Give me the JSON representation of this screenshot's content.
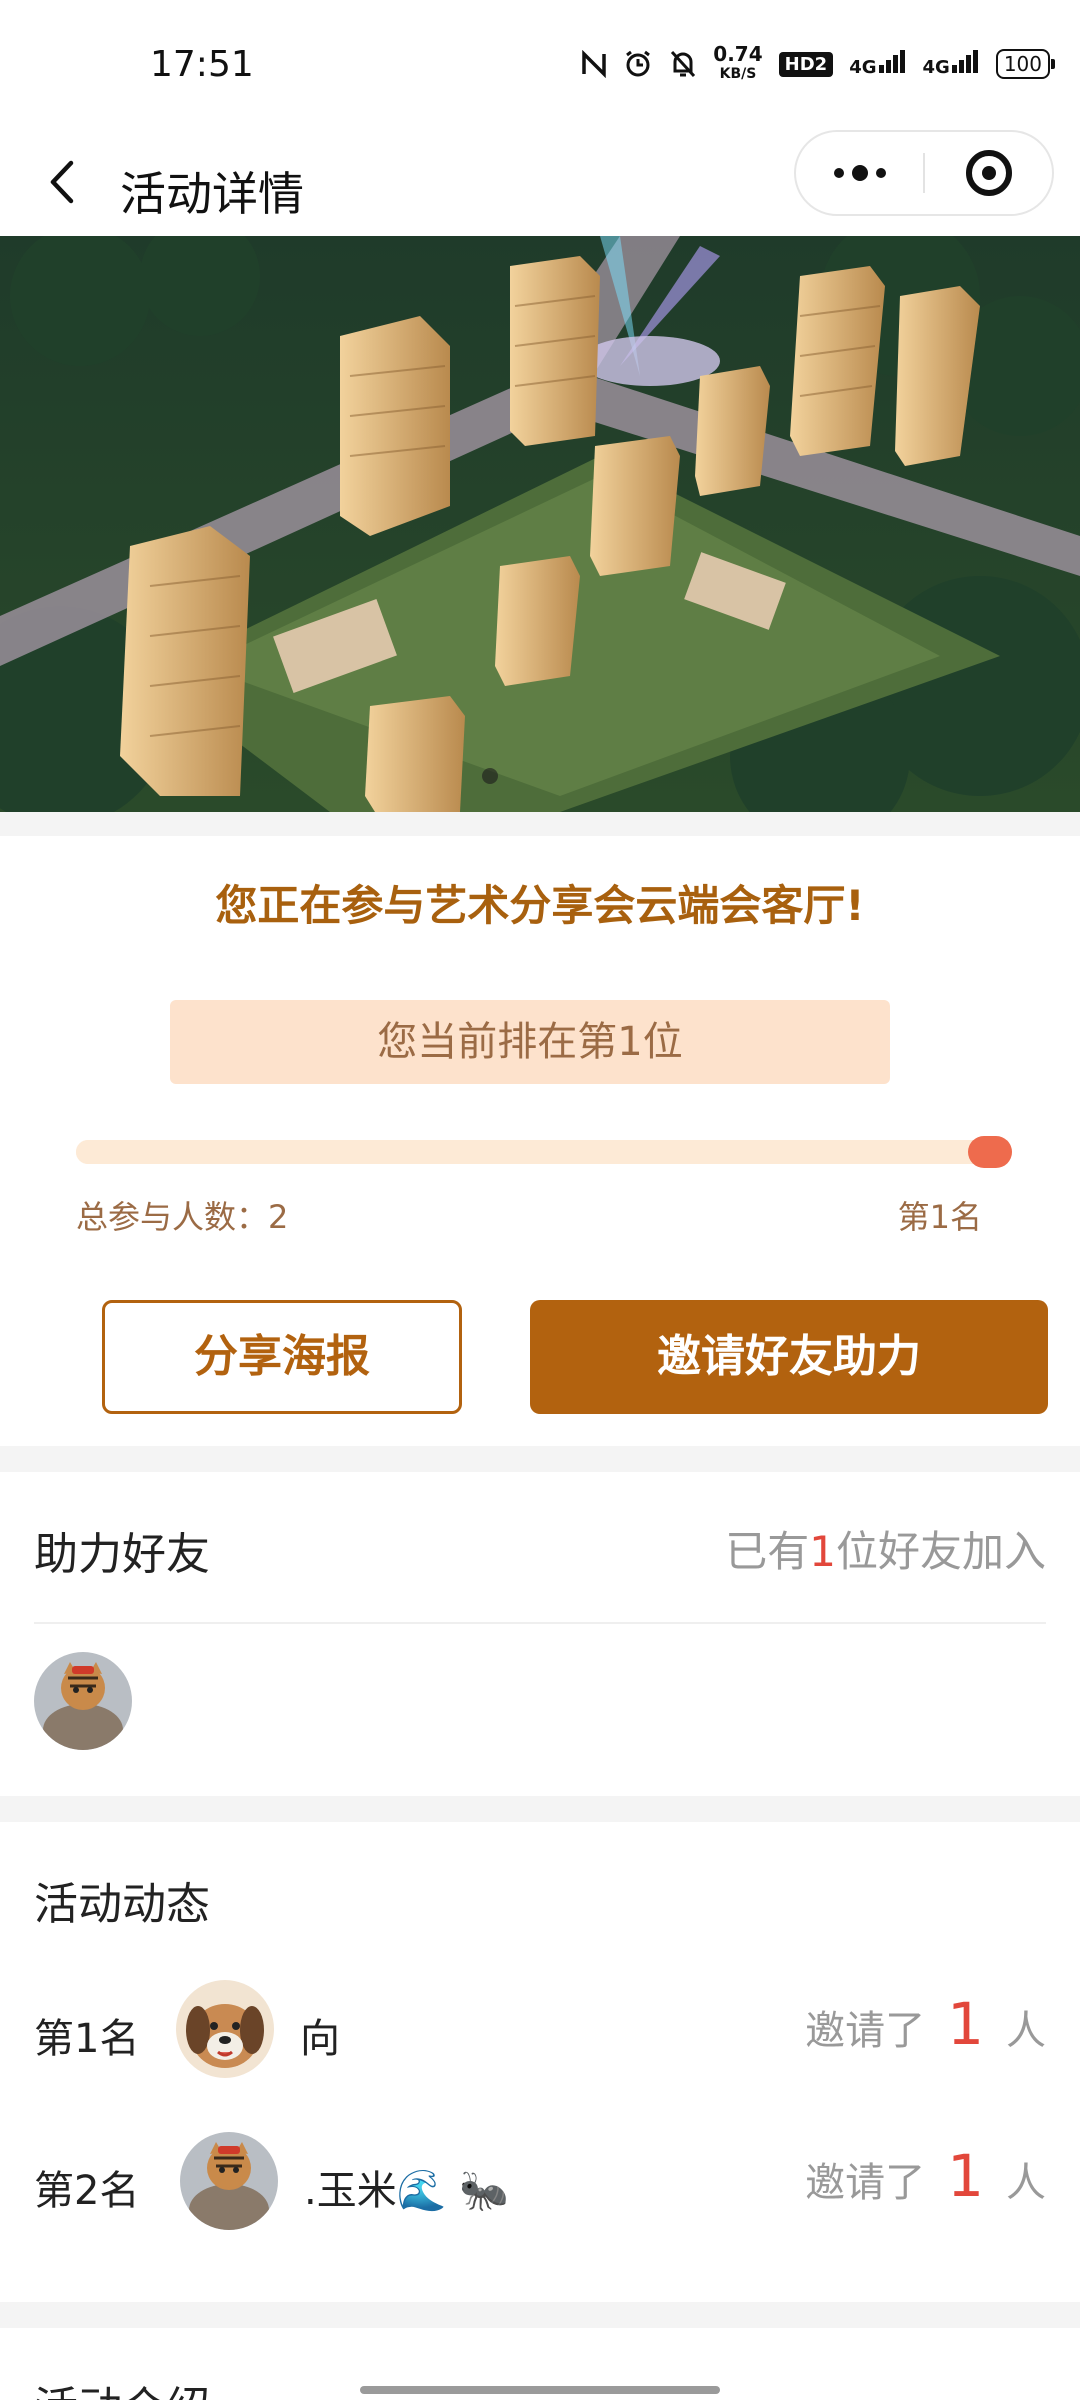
{
  "status_bar": {
    "time": "17:51",
    "speed_value": "0.74",
    "speed_unit": "KB/S",
    "hd_badge": "HD2",
    "signal1": "4G",
    "signal2": "4G",
    "battery": "100"
  },
  "nav": {
    "title": "活动详情"
  },
  "rank_card": {
    "headline": "您正在参与艺术分享会云端会客厅!",
    "current_rank": "您当前排在第1位",
    "total_participants": "总参与人数：2",
    "rank_label": "第1名",
    "progress": 1.0,
    "share_button": "分享海报",
    "invite_button": "邀请好友助力"
  },
  "friends": {
    "title": "助力好友",
    "count_prefix": "已有",
    "count": "1",
    "count_suffix": "位好友加入"
  },
  "activity": {
    "title": "活动动态",
    "rows": [
      {
        "rank": "第1名",
        "name": "向",
        "invite_prefix": "邀请了",
        "count": "1",
        "unit": "人"
      },
      {
        "rank": "第2名",
        "name": ".玉米🌊 🐜",
        "invite_prefix": "邀请了",
        "count": "1",
        "unit": "人"
      }
    ]
  },
  "intro": {
    "title": "活动介绍"
  },
  "colors": {
    "accent": "#b2620f",
    "headline": "#a8600e",
    "pill_bg": "#fde2cc",
    "knob": "#ee6b4d",
    "highlight_red": "#e2473b"
  }
}
